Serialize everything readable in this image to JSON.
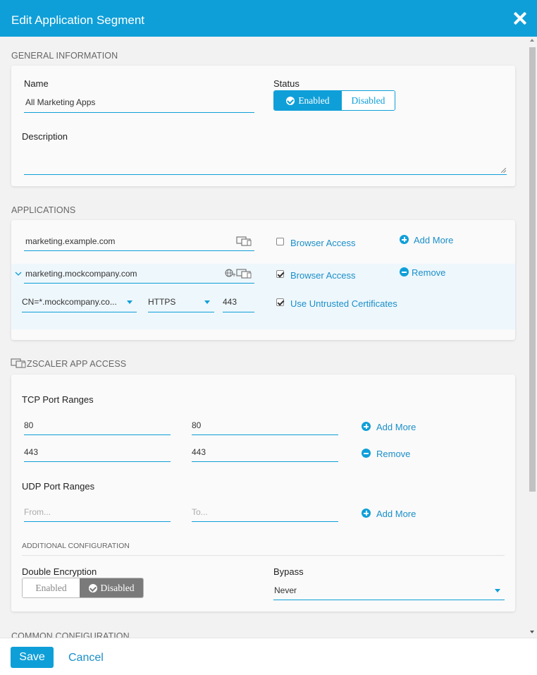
{
  "header": {
    "title": "Edit Application Segment"
  },
  "general": {
    "section_title": "GENERAL INFORMATION",
    "name_label": "Name",
    "name_value": "All Marketing Apps",
    "status_label": "Status",
    "status_enabled": "Enabled",
    "status_disabled": "Disabled",
    "status_selected": "Enabled",
    "description_label": "Description",
    "description_value": ""
  },
  "applications": {
    "section_title": "APPLICATIONS",
    "rows": [
      {
        "domain": "marketing.example.com",
        "browser_access_label": "Browser Access",
        "browser_access": false,
        "action": "Add More"
      },
      {
        "domain": "marketing.mockcompany.com",
        "browser_access_label": "Browser Access",
        "browser_access": true,
        "action": "Remove",
        "plus_sign": "+"
      }
    ],
    "certificate": "CN=*.mockcompany.co...",
    "protocol": "HTTPS",
    "port": "443",
    "untrusted_label": "Use Untrusted Certificates",
    "untrusted": true
  },
  "zscaler": {
    "section_title": "ZSCALER APP ACCESS",
    "tcp_label": "TCP Port Ranges",
    "tcp_rows": [
      {
        "from": "80",
        "to": "80",
        "action": "Add More"
      },
      {
        "from": "443",
        "to": "443",
        "action": "Remove"
      }
    ],
    "udp_label": "UDP Port Ranges",
    "udp_from_placeholder": "From...",
    "udp_to_placeholder": "To...",
    "udp_action": "Add More",
    "additional_title": "ADDITIONAL CONFIGURATION",
    "double_enc_label": "Double Encryption",
    "double_enc_enabled": "Enabled",
    "double_enc_disabled": "Disabled",
    "double_enc_selected": "Disabled",
    "bypass_label": "Bypass",
    "bypass_value": "Never"
  },
  "common": {
    "section_title": "COMMON CONFIGURATION"
  },
  "footer": {
    "save": "Save",
    "cancel": "Cancel"
  },
  "colors": {
    "accent": "#0f9fd8",
    "link": "#1a8fc9",
    "disabled_dark": "#7a7a7a"
  }
}
